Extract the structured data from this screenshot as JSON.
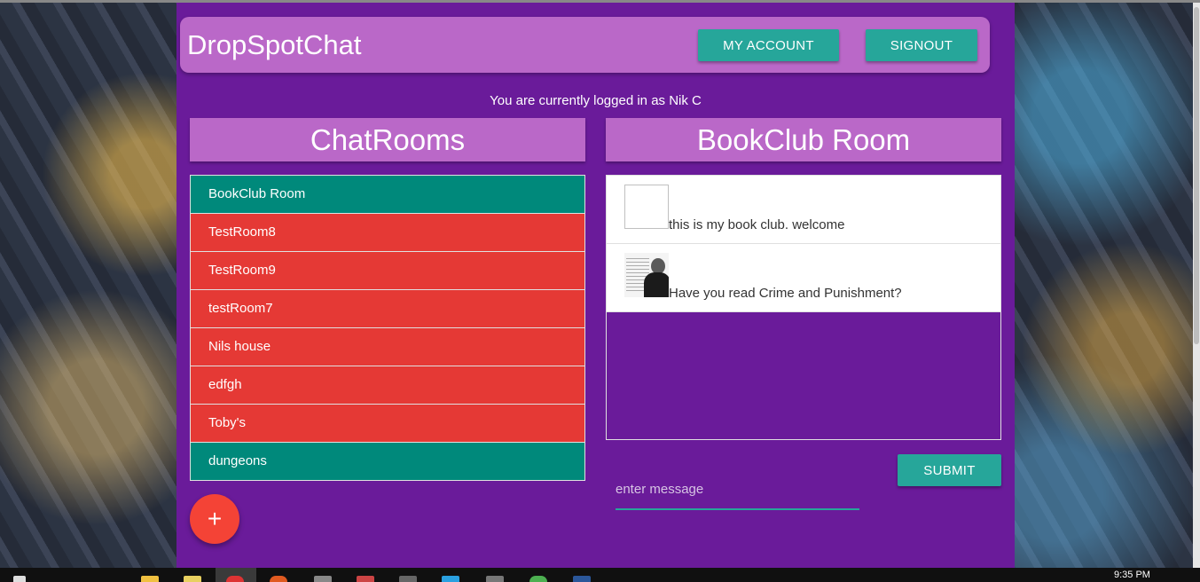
{
  "app": {
    "brand": "DropSpotChat",
    "nav": {
      "account_label": "MY ACCOUNT",
      "signout_label": "SIGNOUT"
    },
    "logged_in_text": "You are currently logged in as Nik C"
  },
  "chatrooms": {
    "title": "ChatRooms",
    "items": [
      {
        "label": "BookClub Room",
        "color": "#00897b"
      },
      {
        "label": "TestRoom8",
        "color": "#e53935"
      },
      {
        "label": "TestRoom9",
        "color": "#e53935"
      },
      {
        "label": "testRoom7",
        "color": "#e53935"
      },
      {
        "label": "Nils house",
        "color": "#e53935"
      },
      {
        "label": "edfgh",
        "color": "#e53935"
      },
      {
        "label": "Toby's",
        "color": "#e53935"
      },
      {
        "label": "dungeons",
        "color": "#00897b"
      }
    ],
    "add_label": "+"
  },
  "room": {
    "title": "BookClub Room",
    "messages": [
      {
        "text": "this is my book club. welcome",
        "avatar": "broken-image-icon"
      },
      {
        "text": "Have you read Crime and Punishment?",
        "avatar": "user-photo"
      }
    ]
  },
  "composer": {
    "placeholder": "enter message",
    "submit_label": "SUBMIT"
  },
  "taskbar": {
    "clock": "9:35 PM"
  },
  "colors": {
    "app_bg": "#6a1b9a",
    "header_bg": "#ba68c8",
    "button": "#26a69a",
    "room_active": "#00897b",
    "room_default": "#e53935",
    "fab": "#f44336"
  }
}
